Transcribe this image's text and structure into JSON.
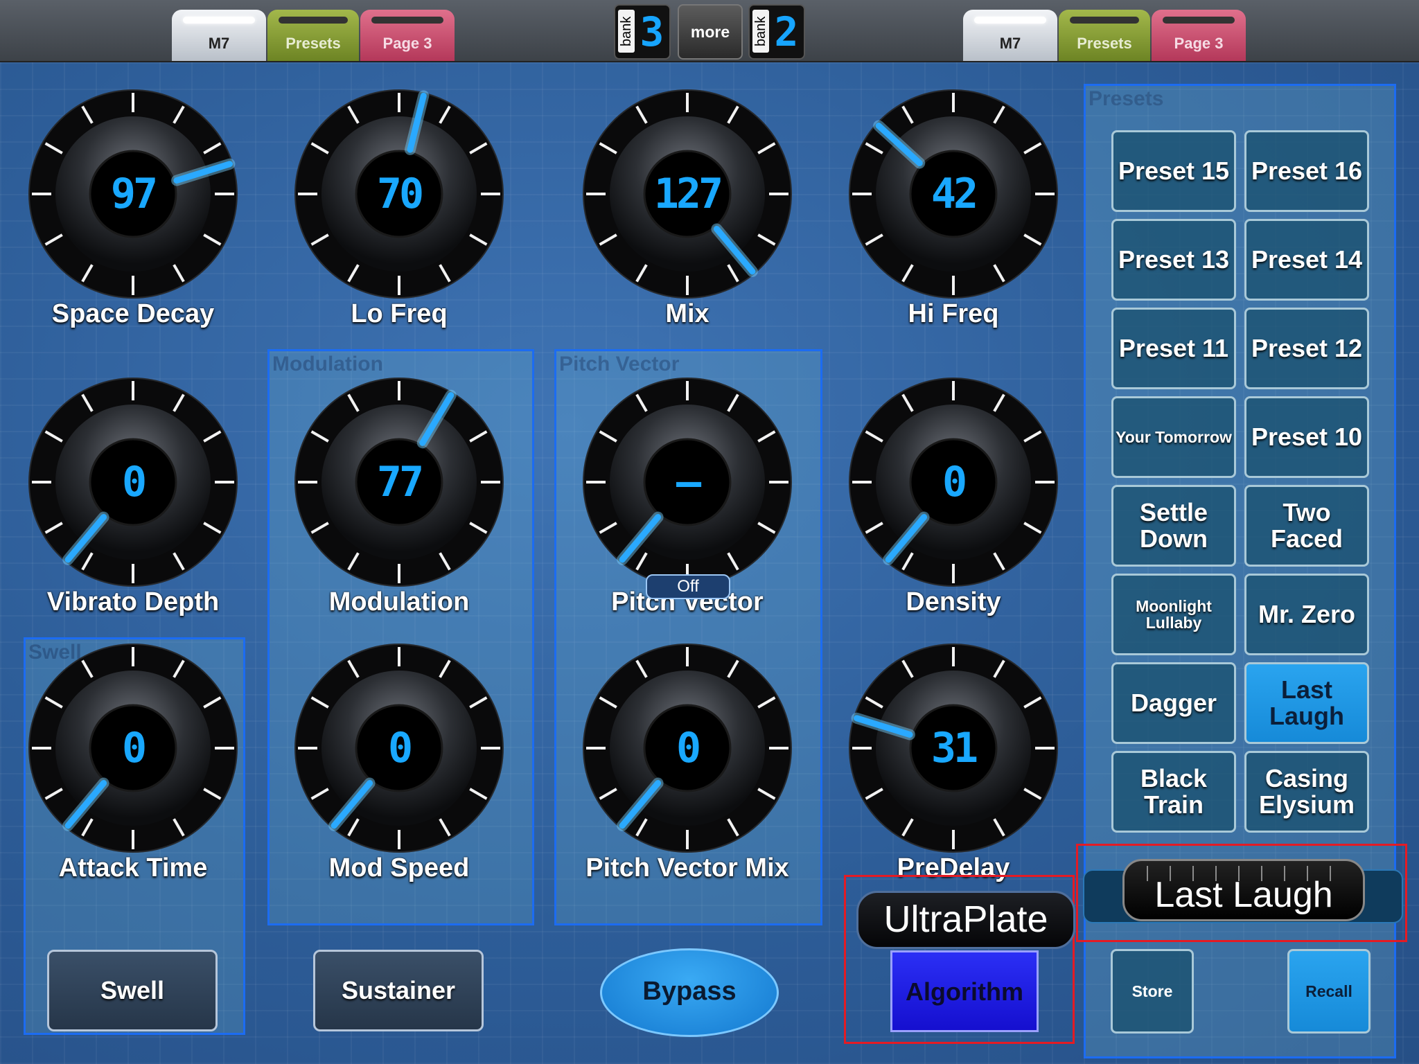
{
  "colors": {
    "accent": "#19a8ff",
    "group_border": "#1c6cf2",
    "highlight_red": "#e41b24",
    "algorithm": "#2b2ff5"
  },
  "header": {
    "left_tabs": [
      {
        "label": "M7"
      },
      {
        "label": "Presets"
      },
      {
        "label": "Page 3"
      }
    ],
    "right_tabs": [
      {
        "label": "M7"
      },
      {
        "label": "Presets"
      },
      {
        "label": "Page 3"
      }
    ],
    "bank_left": {
      "word": "bank",
      "digit": "3"
    },
    "more_label": "more",
    "bank_right": {
      "word": "bank",
      "digit": "2"
    }
  },
  "knobs": [
    {
      "label": "Space Decay",
      "value": "97",
      "level": 0.76
    },
    {
      "label": "Lo Freq",
      "value": "70",
      "level": 0.55
    },
    {
      "label": "Mix",
      "value": "127",
      "level": 1.0
    },
    {
      "label": "Hi Freq",
      "value": "42",
      "level": 0.33
    },
    {
      "label": "Vibrato Depth",
      "value": "0",
      "level": 0
    },
    {
      "label": "Modulation",
      "value": "77",
      "level": 0.61
    },
    {
      "label": "Pitch Vector",
      "value": "—",
      "level": 0
    },
    {
      "label": "Density",
      "value": "0",
      "level": 0
    },
    {
      "label": "Attack Time",
      "value": "0",
      "level": 0
    },
    {
      "label": "Mod Speed",
      "value": "0",
      "level": 0
    },
    {
      "label": "Pitch Vector Mix",
      "value": "0",
      "level": 0
    },
    {
      "label": "PreDelay",
      "value": "31",
      "level": 0.24
    }
  ],
  "pitch_vector_badge": "Off",
  "groups": {
    "swell_watermark": "Swell",
    "modulation_watermark": "Modulation",
    "pitch_vector_watermark": "Pitch Vector",
    "presets_watermark": "Presets"
  },
  "buttons": {
    "swell": "Swell",
    "sustainer": "Sustainer",
    "bypass": "Bypass",
    "algorithm": "Algorithm"
  },
  "algorithm_name": "UltraPlate",
  "presets": [
    {
      "label": "Preset 15"
    },
    {
      "label": "Preset 16"
    },
    {
      "label": "Preset 13"
    },
    {
      "label": "Preset 14"
    },
    {
      "label": "Preset 11"
    },
    {
      "label": "Preset 12"
    },
    {
      "label": "Your Tomorrow",
      "small": true
    },
    {
      "label": "Preset 10"
    },
    {
      "label": "Settle Down"
    },
    {
      "label": "Two Faced"
    },
    {
      "label": "Moonlight Lullaby",
      "small": true
    },
    {
      "label": "Mr. Zero"
    },
    {
      "label": "Dagger"
    },
    {
      "label": "Last Laugh",
      "active": true
    },
    {
      "label": "Black Train"
    },
    {
      "label": "Casing Elysium"
    }
  ],
  "current_preset_name": "Last Laugh",
  "store_label": "Store",
  "recall_label": "Recall"
}
